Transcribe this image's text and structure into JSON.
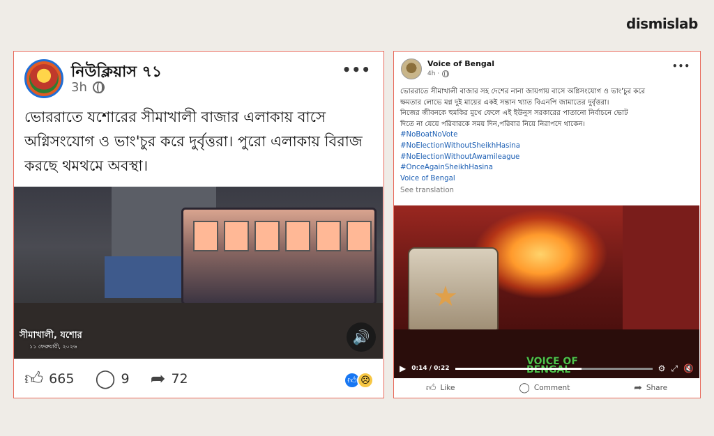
{
  "brand": "dismislab",
  "left_post": {
    "page_name": "নিউক্লিয়াস ৭১",
    "time": "3h",
    "text": "ভোররাতে যশোরের সীমাখালী বাজার এলাকায় বাসে অগ্নিসংযোগ ও ভাং'চুর করে দুর্বৃত্তরা। পুরো এলাকায় বিরাজ করছে থমথমে অবস্থা।",
    "video_caption": "সীমাখালী, যশোর",
    "video_caption_date": "১১ ফেব্রুয়ারী, ২০২৬",
    "likes": "665",
    "comments": "9",
    "shares": "72",
    "menu": "•••"
  },
  "right_post": {
    "page_name": "Voice of Bengal",
    "time": "4h ·",
    "text_line1": "ভোররাতে সীমাখালী বাজার সহ দেশের নানা জায়গায় বাসে অগ্নিসংযোগ ও ভাং'চুর করে",
    "text_line2": "ক্ষমতার লোভে মগ্ন দুই মায়ের একই সন্তান খ্যাত বিএনপি জামাতের দুর্বৃত্তরা।",
    "text_line3": "নিজের জীবনকে হুমকির মুখে ফেলে এই ইউনুস সরকারের পাতানো নির্বাচনে ভোট",
    "text_line4": "দিতে না যেয়ে পরিবারকে সময় দিন,পরিবার নিয়ে নিরাপদে থাকেন।",
    "hashtags": [
      "#NoBoatNoVote",
      "#NoElectionWithoutSheikhHasina",
      "#NoElectionWithoutAwamileague",
      "#OnceAgainSheikhHasina"
    ],
    "signature": "Voice of Bengal",
    "see_translation": "See translation",
    "video_time": "0:14 / 0:22",
    "video_progress": 0.64,
    "watermark_line1": "VOICE OF",
    "watermark_line2": "BENGAL",
    "like_label": "Like",
    "comment_label": "Comment",
    "share_label": "Share",
    "menu": "•••"
  }
}
